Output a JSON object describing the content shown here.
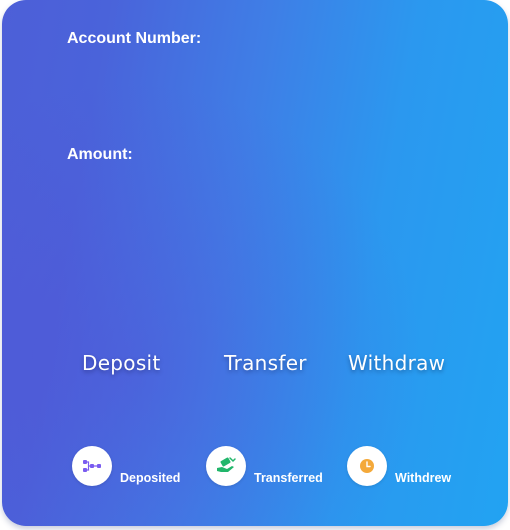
{
  "form": {
    "account_label": "Account Number:",
    "account_value": "",
    "amount_label": "Amount:",
    "amount_value": ""
  },
  "actions": {
    "deposit_label": "Deposit",
    "transfer_label": "Transfer",
    "withdraw_label": "Withdraw"
  },
  "status": {
    "items": [
      {
        "label": "Deposited",
        "icon": "flow-icon",
        "color": "#7a5cf0"
      },
      {
        "label": "Transferred",
        "icon": "hand-money-icon",
        "color": "#21b66b"
      },
      {
        "label": "Withdrew",
        "icon": "clock-icon",
        "color": "#f4a93a"
      }
    ]
  },
  "colors": {
    "gradient_start": "#4d5fd8",
    "gradient_end": "#22a3f2"
  }
}
